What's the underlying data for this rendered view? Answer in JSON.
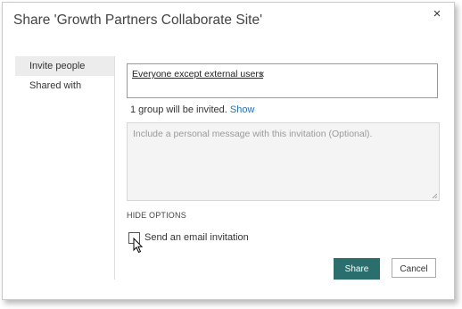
{
  "dialog": {
    "title": "Share 'Growth Partners Collaborate Site'",
    "close_glyph": "×"
  },
  "nav": {
    "items": [
      {
        "label": "Invite people",
        "active": true
      },
      {
        "label": "Shared with",
        "active": false
      }
    ]
  },
  "invite": {
    "token_label": "Everyone except external users",
    "token_remove": "x",
    "count_text": "1 group will be invited.",
    "show_link": "Show",
    "message_placeholder": "Include a personal message with this invitation (Optional).",
    "hide_options": "HIDE OPTIONS",
    "email_invitation_label": "Send an email invitation",
    "email_invitation_checked": false
  },
  "actions": {
    "share_label": "Share",
    "cancel_label": "Cancel"
  },
  "colors": {
    "share_button": "#2b6e6e",
    "link": "#2a6fb0",
    "nav_active_bg": "#ececec"
  },
  "icons": {
    "close": "close-icon",
    "cursor": "mouse-pointer-icon",
    "resize": "resize-grip-icon"
  }
}
